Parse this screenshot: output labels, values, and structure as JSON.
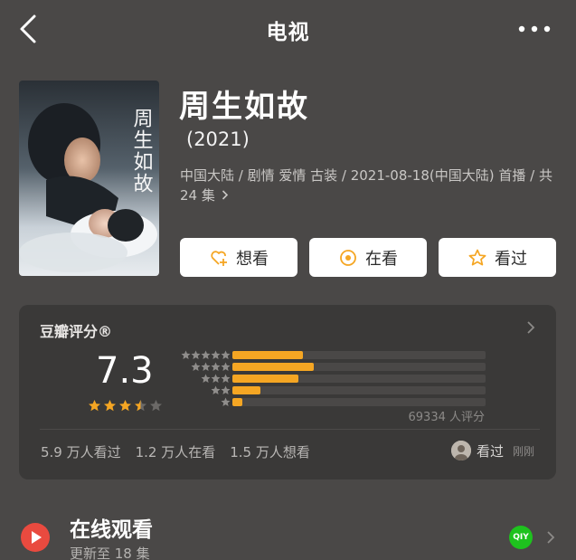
{
  "header": {
    "title": "电视"
  },
  "movie": {
    "title": "周生如故",
    "year": "(2021)",
    "meta": "中国大陆 / 剧情 爱情 古装 / 2021-08-18(中国大陆) 首播 / 共 24 集",
    "poster_text": "周生如故"
  },
  "actions": [
    {
      "label": "想看",
      "icon": "heart-plus-icon"
    },
    {
      "label": "在看",
      "icon": "target-circle-icon"
    },
    {
      "label": "看过",
      "icon": "star-outline-icon"
    }
  ],
  "rating": {
    "label": "豆瓣评分®",
    "score": "7.3",
    "stars_value": 3.5,
    "count_text": "69334 人评分",
    "distribution": [
      0.28,
      0.32,
      0.26,
      0.11,
      0.04
    ],
    "stats": [
      "5.9 万人看过",
      "1.2 万人在看",
      "1.5 万人想看"
    ],
    "viewer": {
      "action": "看过",
      "time": "刚刚"
    }
  },
  "online": {
    "title": "在线观看",
    "subtitle": "更新至 18 集",
    "platform_text": "QIY"
  },
  "colors": {
    "background": "#4a4847",
    "card": "#3a3938",
    "accent": "#f5a623",
    "play_red": "#e94a3f",
    "iqiyi_green": "#1ec21e"
  }
}
